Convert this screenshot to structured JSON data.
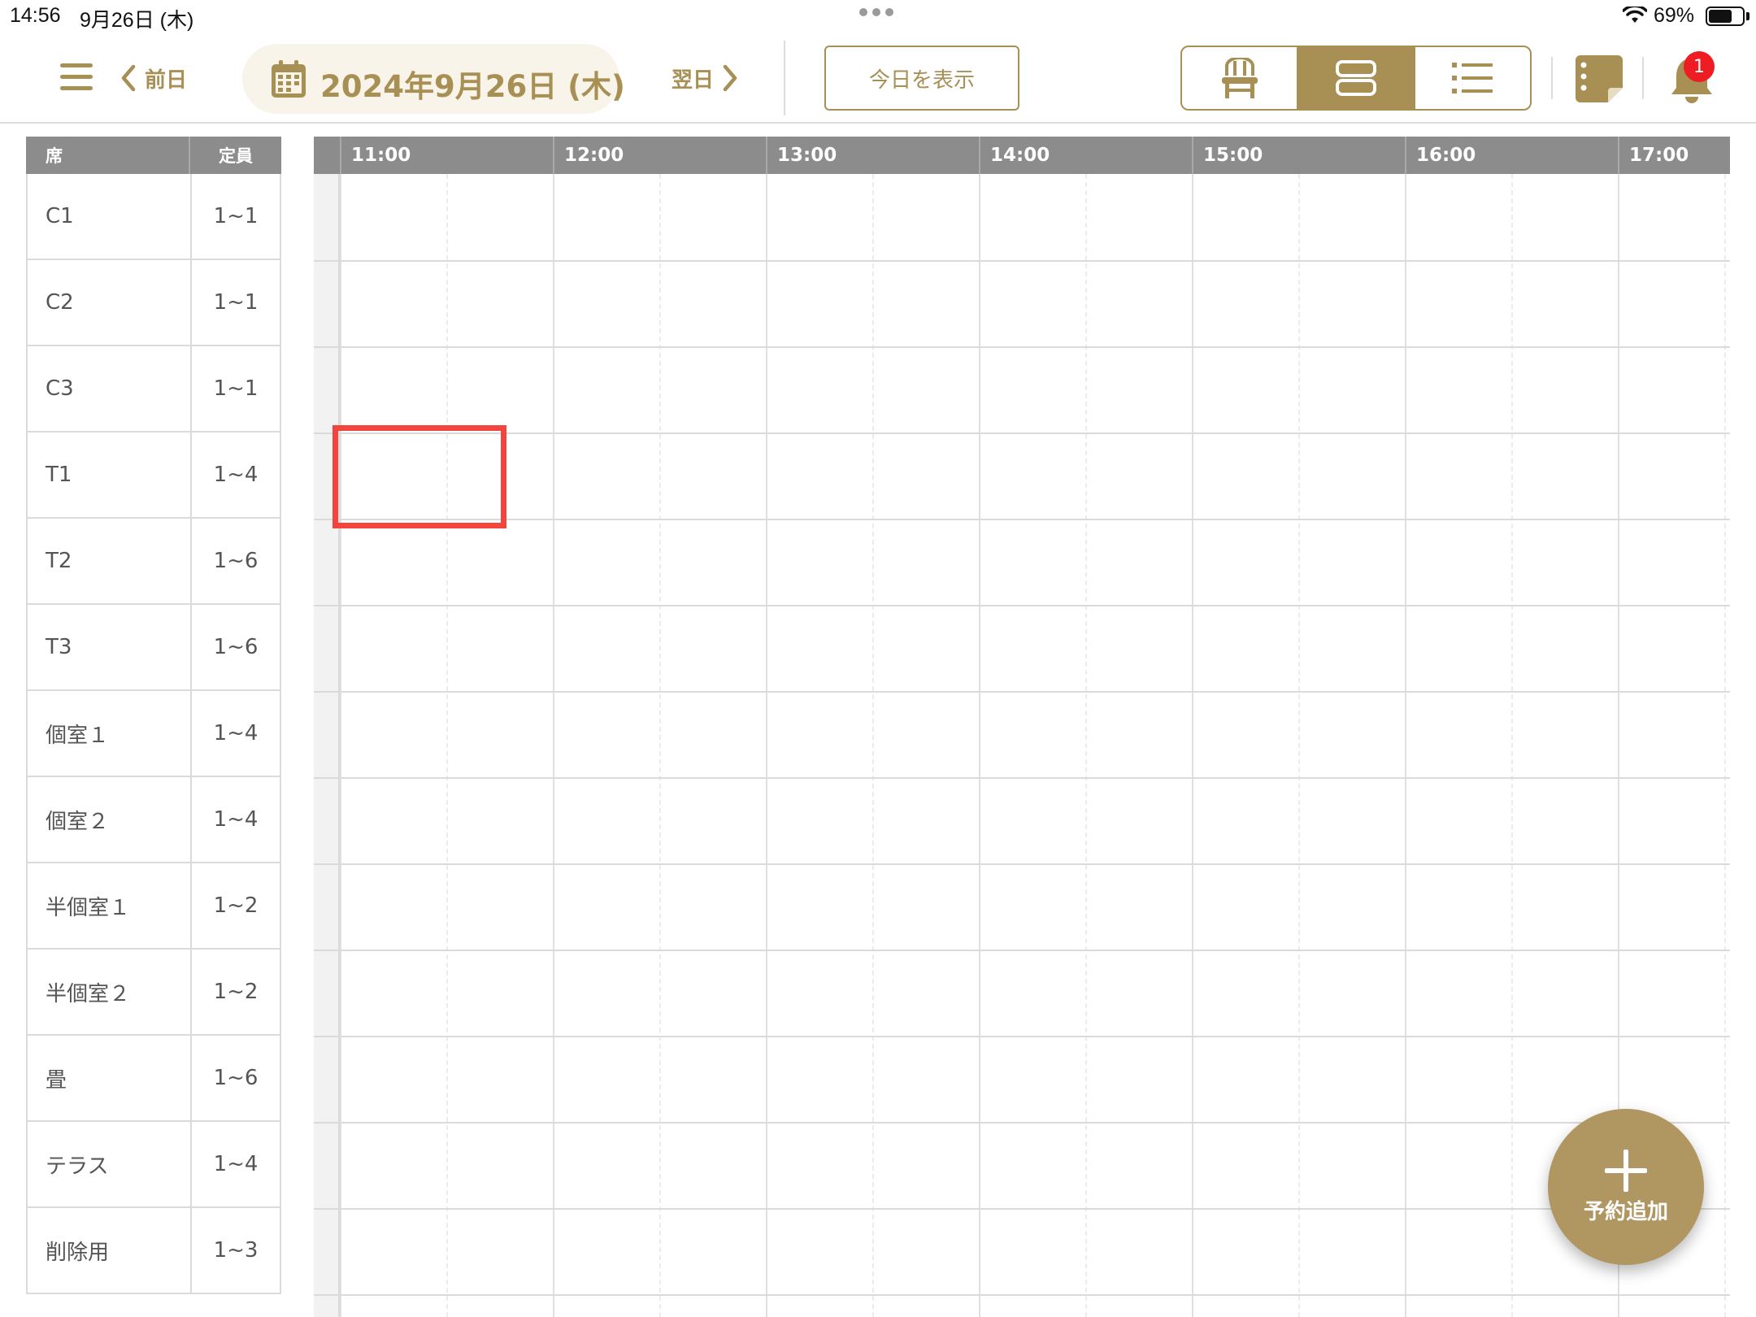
{
  "status_bar": {
    "time": "14:56",
    "date": "9月26日 (木)",
    "battery": "69%",
    "battery_level": 0.69
  },
  "toolbar": {
    "prev_label": "前日",
    "date_label": "2024年9月26日 (木)",
    "next_label": "翌日",
    "today_label": "今日を表示",
    "notification_count": "1",
    "view_modes": [
      "seat-view",
      "timeline-view",
      "list-view"
    ],
    "active_view": "timeline-view"
  },
  "seat_table": {
    "header_seat": "席",
    "header_capacity": "定員",
    "rows": [
      {
        "seat": "C1",
        "capacity": "1~1"
      },
      {
        "seat": "C2",
        "capacity": "1~1"
      },
      {
        "seat": "C3",
        "capacity": "1~1"
      },
      {
        "seat": "T1",
        "capacity": "1~4"
      },
      {
        "seat": "T2",
        "capacity": "1~6"
      },
      {
        "seat": "T3",
        "capacity": "1~6"
      },
      {
        "seat": "個室１",
        "capacity": "1~4"
      },
      {
        "seat": "個室２",
        "capacity": "1~4"
      },
      {
        "seat": "半個室１",
        "capacity": "1~2"
      },
      {
        "seat": "半個室２",
        "capacity": "1~2"
      },
      {
        "seat": "畳",
        "capacity": "1~6"
      },
      {
        "seat": "テラス",
        "capacity": "1~4"
      },
      {
        "seat": "削除用",
        "capacity": "1~3"
      }
    ]
  },
  "timeline": {
    "hours": [
      "11:00",
      "12:00",
      "13:00",
      "14:00",
      "15:00",
      "16:00",
      "17:00"
    ]
  },
  "fab": {
    "label": "予約追加"
  },
  "colors": {
    "accent": "#a88f54",
    "header_gray": "#8c8c8c",
    "highlight": "#f2453d",
    "badge": "#ee1c23"
  }
}
